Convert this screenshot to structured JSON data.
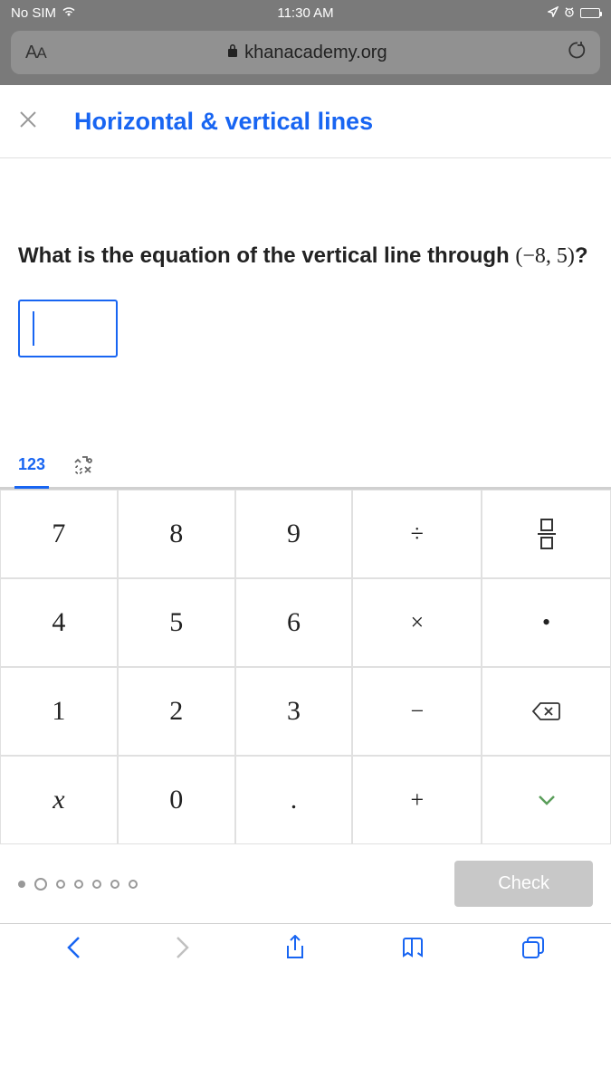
{
  "status": {
    "carrier": "No SIM",
    "time": "11:30 AM"
  },
  "urlbar": {
    "aa": "AA",
    "domain": "khanacademy.org"
  },
  "header": {
    "title": "Horizontal & vertical lines"
  },
  "question": {
    "prefix": "What is the equation of the vertical line through ",
    "point": "(−8, 5)",
    "suffix": "?"
  },
  "tabs": {
    "numbers": "123"
  },
  "keys": {
    "k7": "7",
    "k8": "8",
    "k9": "9",
    "k4": "4",
    "k5": "5",
    "k6": "6",
    "k1": "1",
    "k2": "2",
    "k3": "3",
    "k0": "0",
    "kdot": ".",
    "kdiv": "÷",
    "kmul": "×",
    "kmin": "−",
    "kplus": "+",
    "kx": "x",
    "kfdot": "•"
  },
  "check": "Check"
}
